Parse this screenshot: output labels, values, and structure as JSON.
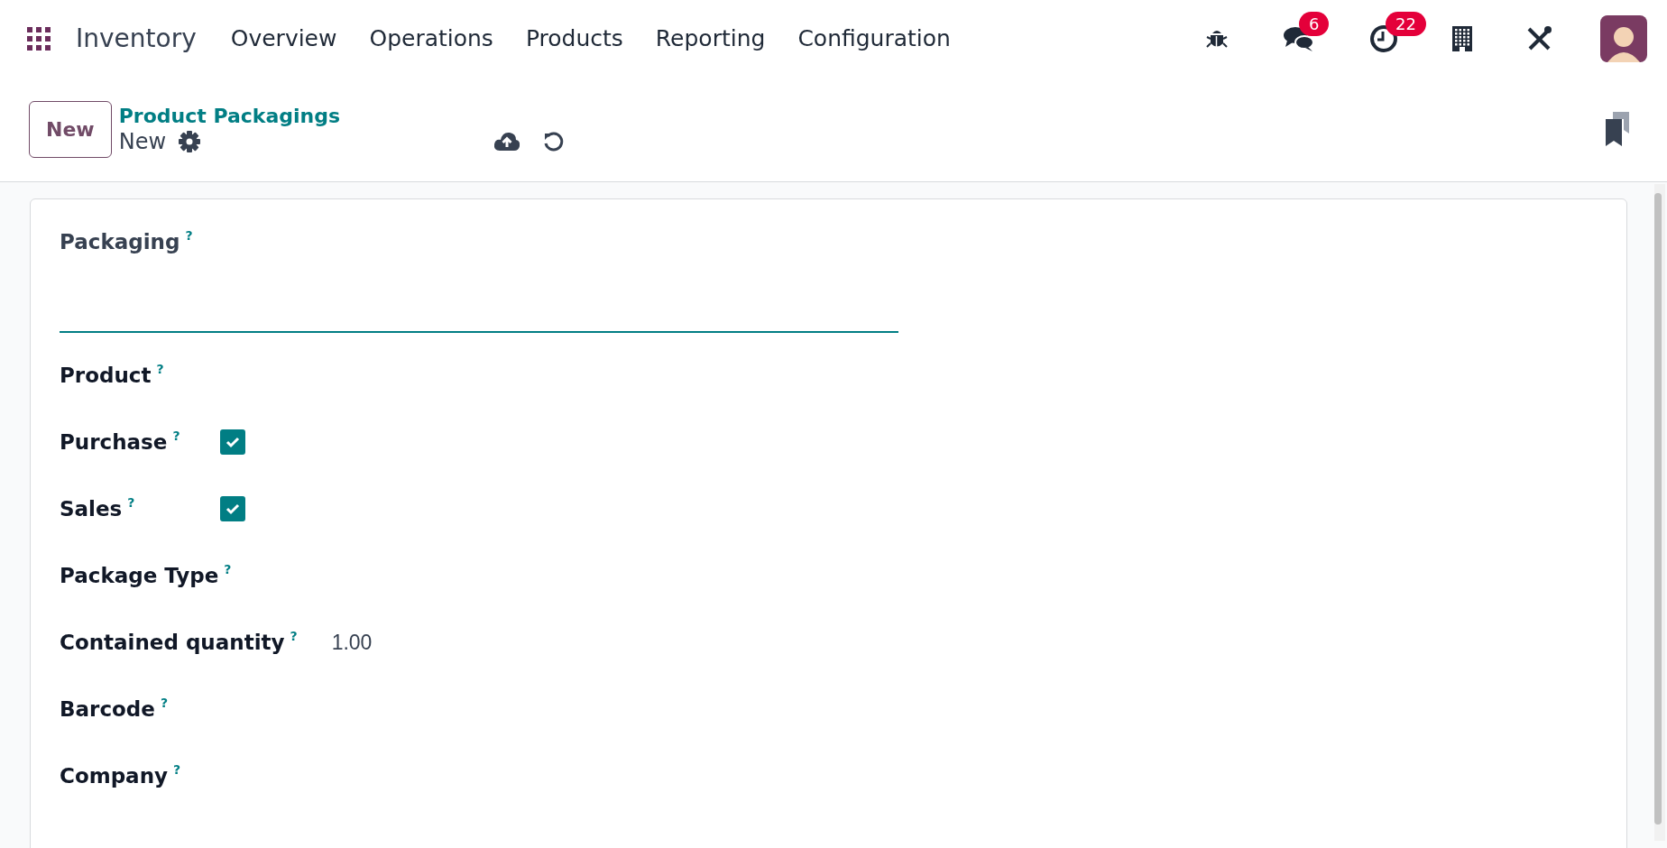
{
  "navbar": {
    "app_name": "Inventory",
    "menu": [
      {
        "label": "Overview"
      },
      {
        "label": "Operations"
      },
      {
        "label": "Products"
      },
      {
        "label": "Reporting"
      },
      {
        "label": "Configuration"
      }
    ],
    "messages_badge": "6",
    "activities_badge": "22"
  },
  "control_panel": {
    "new_button": "New",
    "breadcrumb": "Product Packagings",
    "record_title": "New"
  },
  "form": {
    "fields": [
      {
        "kind": "title",
        "label": "Packaging",
        "help": "?"
      },
      {
        "kind": "text",
        "label": "Product",
        "help": "?"
      },
      {
        "kind": "checkbox",
        "label": "Purchase",
        "help": "?",
        "checked": true
      },
      {
        "kind": "checkbox",
        "label": "Sales",
        "help": "?",
        "checked": true
      },
      {
        "kind": "text",
        "label": "Package Type",
        "help": "?"
      },
      {
        "kind": "value",
        "label": "Contained quantity",
        "help": "?",
        "value": "1.00"
      },
      {
        "kind": "text",
        "label": "Barcode",
        "help": "?"
      },
      {
        "kind": "text",
        "label": "Company",
        "help": "?"
      }
    ]
  }
}
